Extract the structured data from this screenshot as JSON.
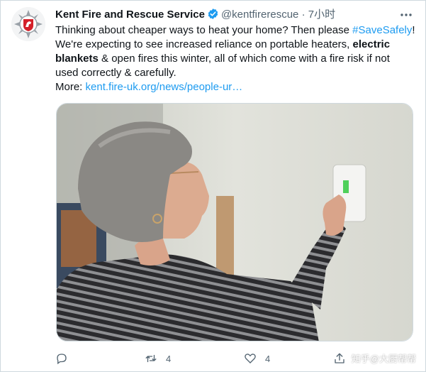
{
  "tweet": {
    "author_name": "Kent Fire and Rescue Service",
    "handle": "@kentfirerescue",
    "separator": "·",
    "time": "7小时",
    "text": {
      "p1": "Thinking about cheaper ways to heat your home? Then please ",
      "hashtag": "#SaveSafely",
      "p2": "! We're expecting to see increased reliance on portable heaters, ",
      "bold": "electric blankets",
      "p3": " & open fires this winter, all of which come with a fire risk if not used correctly & carefully.",
      "more_label": "More: ",
      "link": "kent.fire-uk.org/news/people-ur…"
    },
    "media_alt": "woman adjusting thermostat",
    "actions": {
      "reply_icon": "reply-icon",
      "retweet_icon": "retweet-icon",
      "retweet_count": "4",
      "like_icon": "heart-icon",
      "like_count": "4",
      "share_icon": "share-icon"
    }
  },
  "watermark": "知乎@大厨帮帮",
  "colors": {
    "accent": "#1d9bf0",
    "text": "#0f1419",
    "muted": "#536471",
    "border": "#cfd9de"
  }
}
